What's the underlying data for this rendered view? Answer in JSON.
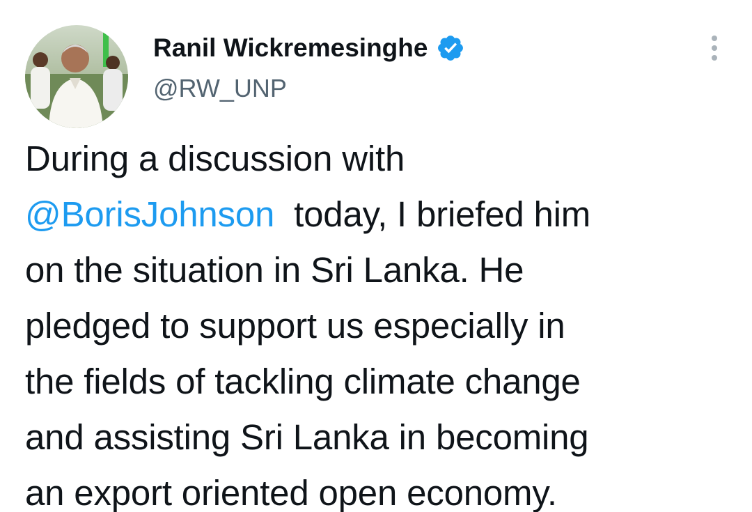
{
  "author": {
    "display_name": "Ranil Wickremesinghe",
    "handle": "@RW_UNP",
    "verified": true,
    "avatar_icon": "profile-photo"
  },
  "tweet": {
    "lines": [
      "During a discussion with",
      "today, I briefed him",
      "on the situation in Sri Lanka. He",
      "pledged to support us especially in",
      "the fields of tackling climate change",
      "and assisting Sri Lanka in becoming",
      "an export oriented open economy."
    ],
    "mention": "@BorisJohnson"
  },
  "colors": {
    "accent": "#1d9bf0",
    "text": "#0f1419",
    "secondary": "#536471"
  },
  "icons": {
    "more": "more-vertical-icon",
    "verified": "verified-badge-icon"
  }
}
